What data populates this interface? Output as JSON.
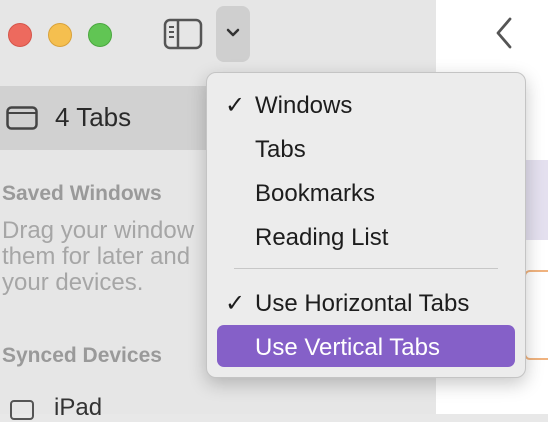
{
  "sidebar": {
    "tabs_count_label": "4 Tabs",
    "saved_windows_title": "Saved Windows",
    "saved_windows_desc": "Drag your window\nthem for later and\nyour devices.",
    "synced_devices_title": "Synced Devices",
    "device_label": "iPad"
  },
  "menu": {
    "items": [
      {
        "label": "Windows",
        "check": "✓"
      },
      {
        "label": "Tabs",
        "check": ""
      },
      {
        "label": "Bookmarks",
        "check": ""
      },
      {
        "label": "Reading List",
        "check": ""
      },
      {
        "label": "Use Horizontal Tabs",
        "check": "✓"
      },
      {
        "label": "Use Vertical Tabs",
        "check": ""
      }
    ],
    "selected_index": 5
  },
  "colors": {
    "accent": "#8560c8",
    "close": "#ed6a5e",
    "minimize": "#f5bf4f",
    "maximize": "#61c554"
  }
}
